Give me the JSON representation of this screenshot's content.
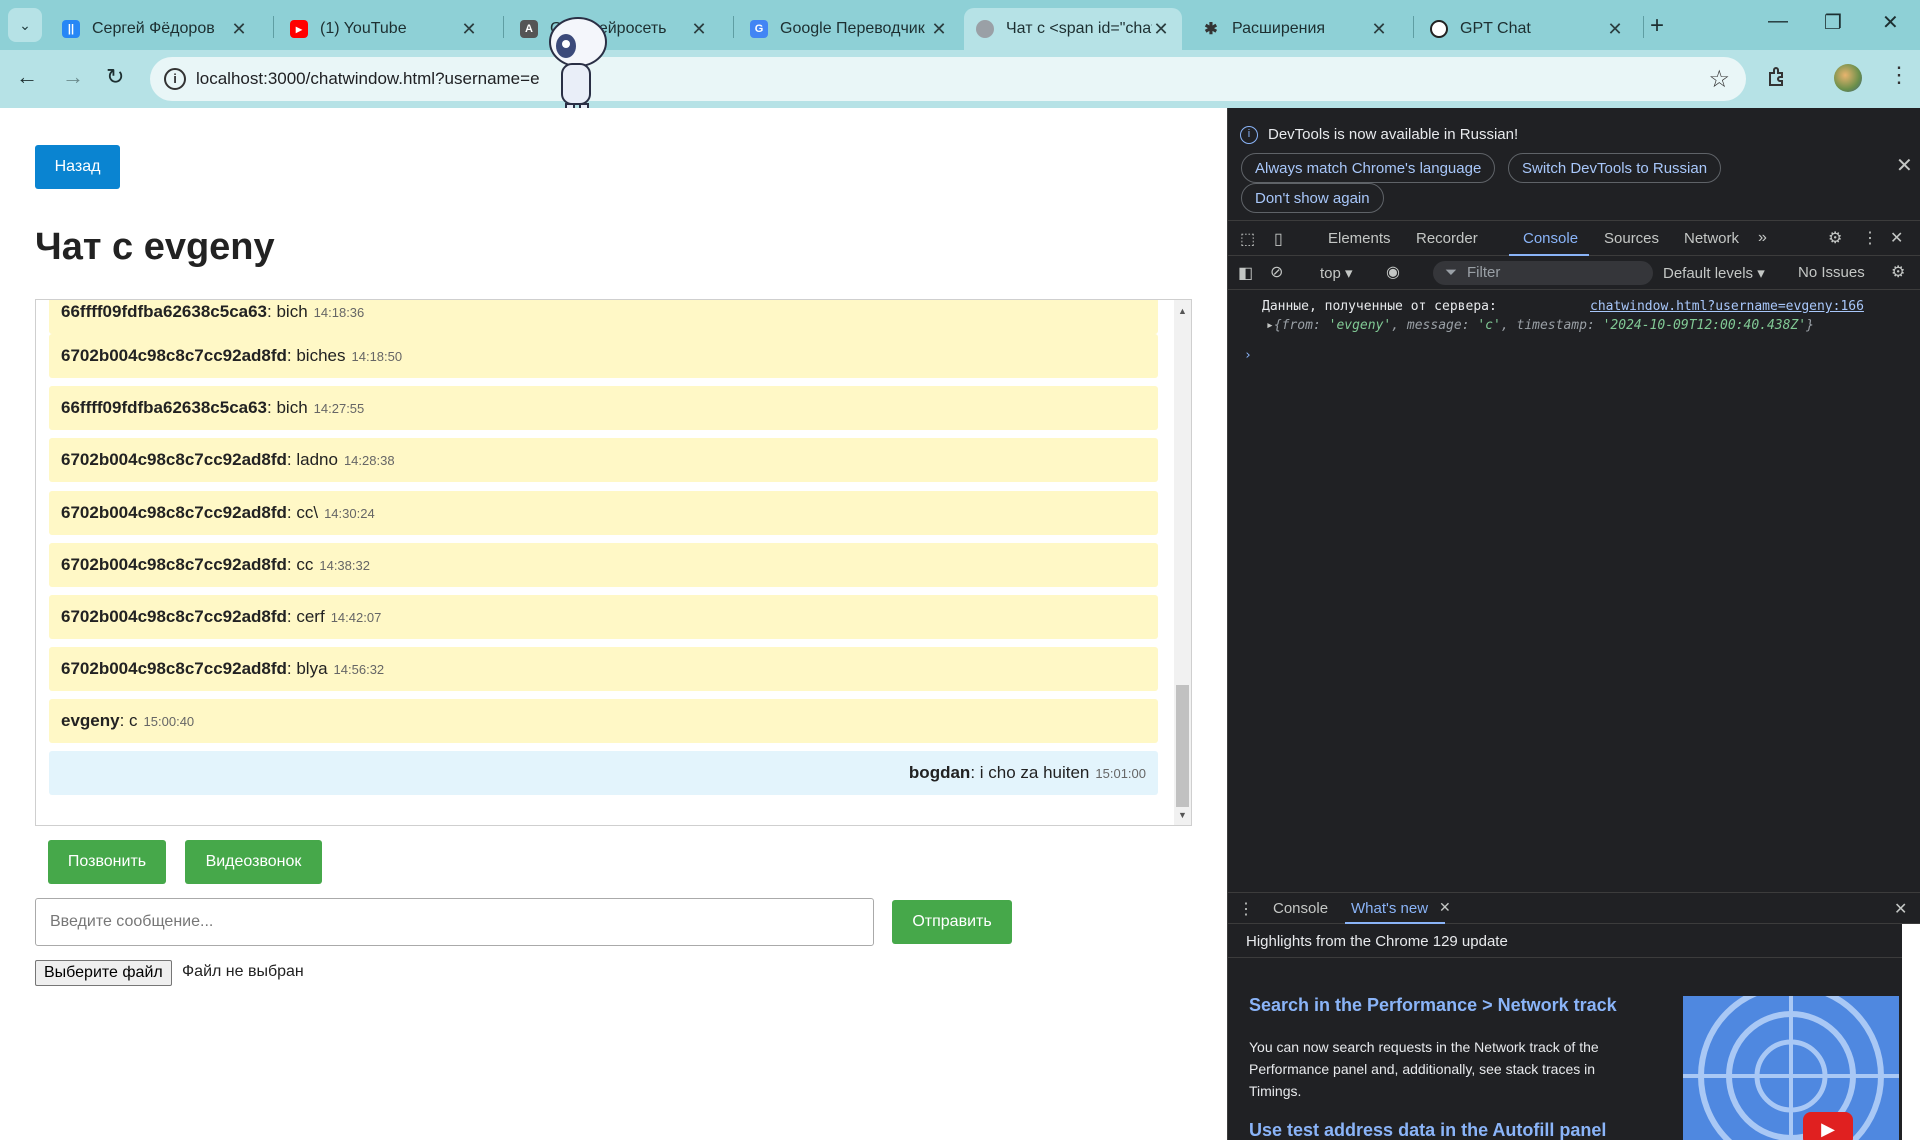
{
  "browser": {
    "tabs": [
      {
        "title": "Сергей Фёдоров",
        "favicon": "vk-icon",
        "color": "#2787f5"
      },
      {
        "title": "(1) YouTube",
        "favicon": "youtube-icon",
        "color": "#ff0000"
      },
      {
        "title": "GPT: нейросеть",
        "favicon": "gpt-site-icon",
        "color": "#555555"
      },
      {
        "title": "Google Переводчик",
        "favicon": "google-translate-icon",
        "color": "#4285f4"
      },
      {
        "title": "Чат с <span id=\"chat",
        "favicon": "globe-icon",
        "color": "#666666",
        "active": true
      },
      {
        "title": "Расширения",
        "favicon": "puzzle-icon",
        "color": "#333333"
      },
      {
        "title": "GPT Chat",
        "favicon": "openai-icon",
        "color": "#222222"
      }
    ],
    "url": "localhost:3000/chatwindow.html?username=e",
    "colors": {
      "frame": "#8ed0d6",
      "toolbar": "#b6e2e6"
    }
  },
  "page": {
    "back_label": "Назад",
    "title": "Чат с evgeny",
    "messages": [
      {
        "from": "66ffff09fdfba62638c5ca63",
        "text": ": bich",
        "time": "14:18:36"
      },
      {
        "from": "6702b004c98c8c7cc92ad8fd",
        "text": ": biches",
        "time": "14:18:50"
      },
      {
        "from": "66ffff09fdfba62638c5ca63",
        "text": ": bich",
        "time": "14:27:55"
      },
      {
        "from": "6702b004c98c8c7cc92ad8fd",
        "text": ": ladno",
        "time": "14:28:38"
      },
      {
        "from": "6702b004c98c8c7cc92ad8fd",
        "text": ": cc\\",
        "time": "14:30:24"
      },
      {
        "from": "6702b004c98c8c7cc92ad8fd",
        "text": ": cc",
        "time": "14:38:32"
      },
      {
        "from": "6702b004c98c8c7cc92ad8fd",
        "text": ": cerf",
        "time": "14:42:07"
      },
      {
        "from": "6702b004c98c8c7cc92ad8fd",
        "text": ": blya",
        "time": "14:56:32"
      },
      {
        "from": "evgeny",
        "text": ": c",
        "time": "15:00:40"
      },
      {
        "from": "bogdan",
        "text": ": i cho za huiten",
        "time": "15:01:00",
        "own": true
      }
    ],
    "call_label": "Позвонить",
    "video_label": "Видеозвонок",
    "input_placeholder": "Введите сообщение...",
    "send_label": "Отправить",
    "file_button": "Выберите файл",
    "file_status": "Файл не выбран",
    "colors": {
      "primary": "#0a84d1",
      "success": "#46a84a",
      "incoming": "#fff8c6",
      "outgoing": "#e3f4fc"
    }
  },
  "devtools": {
    "info_text": "DevTools is now available in Russian!",
    "btn_match": "Always match Chrome's language",
    "btn_switch": "Switch DevTools to Russian",
    "btn_dont_show": "Don't show again",
    "tabs": [
      "Elements",
      "Recorder",
      "Console",
      "Sources",
      "Network"
    ],
    "active_tab": "Console",
    "context": "top",
    "filter_placeholder": "Filter",
    "levels": "Default levels",
    "issues": "No Issues",
    "log_text": "Данные, полученные от сервера:",
    "log_source": "chatwindow.html?username=evgeny:166",
    "log_object": {
      "k1": "from",
      "v1": "'evgeny'",
      "k2": "message",
      "v2": "'c'",
      "k3": "timestamp",
      "v3": "'2024-10-09T12:00:40.438Z'"
    },
    "drawer_tabs": [
      "Console",
      "What's new"
    ],
    "whats_new": {
      "highlights": "Highlights from the Chrome 129 update",
      "h1": "Search in the Performance > Network track",
      "p1": "You can now search requests in the Network track of the Performance panel and, additionally, see stack traces in Timings.",
      "h2": "Use test address data in the Autofill panel"
    }
  }
}
